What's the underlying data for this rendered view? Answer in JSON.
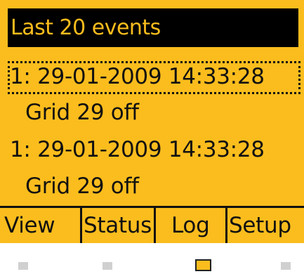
{
  "screen": {
    "title": "Last 20 events",
    "events": [
      {
        "timestamp": "1: 29-01-2009  14:33:28",
        "description": "Grid 29 off",
        "selected": true
      },
      {
        "timestamp": "1: 29-01-2009  14:33:28",
        "description": "Grid 29 off",
        "selected": false
      }
    ]
  },
  "softkeys": {
    "view": "View",
    "status": "Status",
    "log": "Log",
    "setup": "Setup"
  },
  "page_indicator": {
    "count": 4,
    "active_index": 2
  },
  "colors": {
    "display_background": "#fbbd1d",
    "title_background": "#000000",
    "text": "#111111"
  }
}
